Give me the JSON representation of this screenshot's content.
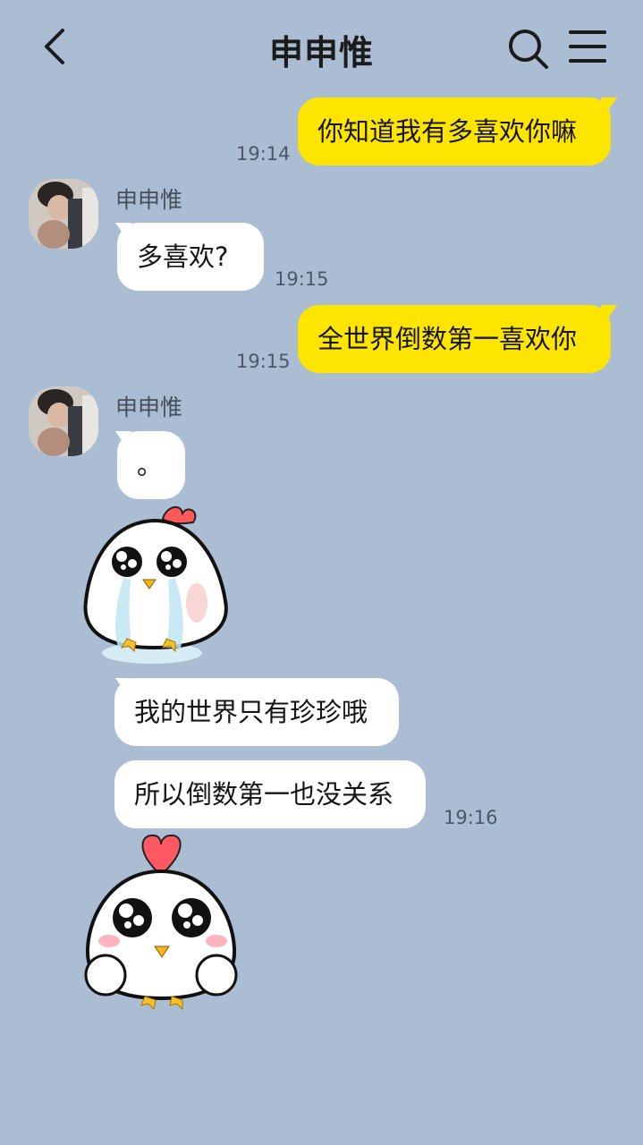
{
  "header": {
    "title": "申申惟",
    "back_icon": "chevron-left-icon",
    "search_icon": "search-icon",
    "menu_icon": "hamburger-menu-icon"
  },
  "colors": {
    "background": "#abbdd3",
    "sent_bubble": "#fee500",
    "received_bubble": "#ffffff"
  },
  "messages": [
    {
      "side": "sent",
      "text": "你知道我有多喜欢你嘛",
      "time": "19:14"
    },
    {
      "side": "received",
      "sender": "申申惟",
      "text": "多喜欢?",
      "time": "19:15"
    },
    {
      "side": "sent",
      "text": "全世界倒数第一喜欢你",
      "time": "19:15"
    },
    {
      "side": "received",
      "sender": "申申惟",
      "text": "。",
      "time": ""
    },
    {
      "side": "received",
      "sticker": "crying-chick-sticker"
    },
    {
      "side": "received",
      "text": "我的世界只有珍珍哦",
      "time": ""
    },
    {
      "side": "received",
      "text": "所以倒数第一也没关系",
      "time": "19:16"
    },
    {
      "side": "received",
      "sticker": "heart-chick-sticker"
    }
  ]
}
